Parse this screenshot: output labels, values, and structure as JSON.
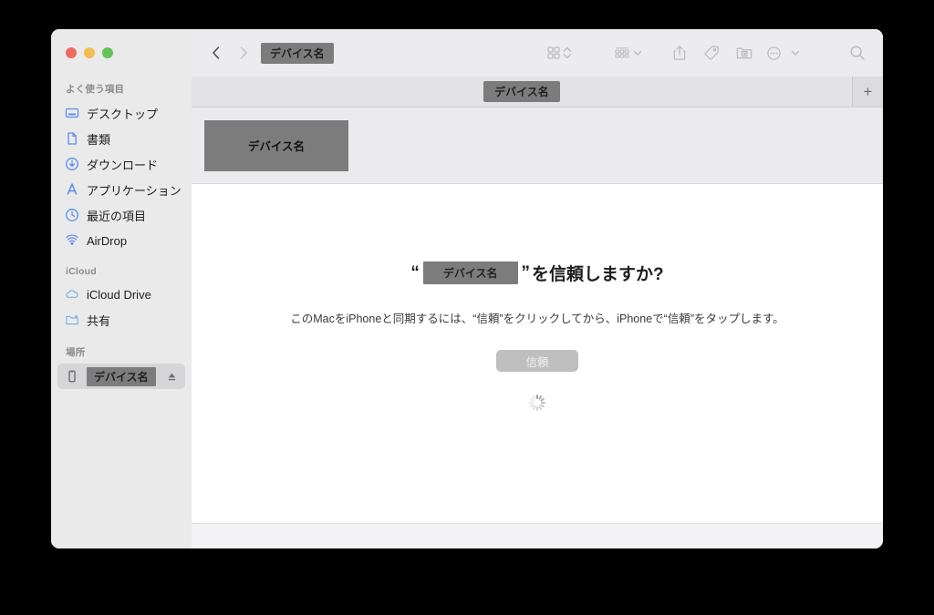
{
  "window": {
    "traffic_lights": [
      {
        "name": "close",
        "color": "#ED6A5E"
      },
      {
        "name": "minimize",
        "color": "#F4BD4F"
      },
      {
        "name": "maximize",
        "color": "#61C454"
      }
    ]
  },
  "sidebar": {
    "sections": [
      {
        "title": "よく使う項目",
        "items": [
          {
            "label": "デスクトップ",
            "icon": "desktop-icon"
          },
          {
            "label": "書類",
            "icon": "document-icon"
          },
          {
            "label": "ダウンロード",
            "icon": "downloads-icon"
          },
          {
            "label": "アプリケーション",
            "icon": "applications-icon"
          },
          {
            "label": "最近の項目",
            "icon": "recents-clock-icon"
          },
          {
            "label": "AirDrop",
            "icon": "airdrop-icon"
          }
        ]
      },
      {
        "title": "iCloud",
        "items": [
          {
            "label": "iCloud Drive",
            "icon": "cloud-icon"
          },
          {
            "label": "共有",
            "icon": "shared-folder-icon"
          }
        ]
      },
      {
        "title": "場所",
        "items": [
          {
            "label": "デバイス名",
            "icon": "iphone-icon",
            "selected": true,
            "redacted": true,
            "eject": true
          }
        ]
      }
    ]
  },
  "toolbar": {
    "back_label": "‹",
    "forward_label": "›",
    "path_chip": "デバイス名",
    "items": [
      {
        "name": "view-grid-button",
        "icon": "grid-view-icon"
      },
      {
        "name": "view-stepper",
        "icon": "chevron-up-down-icon"
      },
      {
        "name": "group-by-button",
        "icon": "group-by-icon"
      },
      {
        "name": "group-by-chevron",
        "icon": "chevron-down-icon"
      },
      {
        "name": "share-button",
        "icon": "share-icon"
      },
      {
        "name": "tag-button",
        "icon": "tag-icon"
      },
      {
        "name": "folder-action-button",
        "icon": "folder-archive-icon"
      },
      {
        "name": "more-button",
        "icon": "ellipsis-circle-icon"
      },
      {
        "name": "more-chevron",
        "icon": "chevron-down-icon"
      },
      {
        "name": "search-button",
        "icon": "search-icon"
      }
    ]
  },
  "tab_bar": {
    "active_tab_label": "デバイス名",
    "new_tab_label": "+"
  },
  "icon_strip": {
    "device_thumb_label": "デバイス名"
  },
  "content": {
    "heading_open_quote": "“",
    "heading_device": "デバイス名",
    "heading_close_quote": "”",
    "heading_suffix": "を信頼しますか?",
    "body": "このMacをiPhoneと同期するには、“信頼”をクリックしてから、iPhoneで“信頼”をタップします。",
    "trust_button_label": "信頼",
    "spinner_name": "loading-spinner"
  },
  "colors": {
    "redaction": "#7c7c7c",
    "sidebar_bg": "#eaeaea",
    "toolbar_bg": "#ececee",
    "accent_blue": "#5b8dee",
    "disabled_button": "#bfbfbf"
  }
}
